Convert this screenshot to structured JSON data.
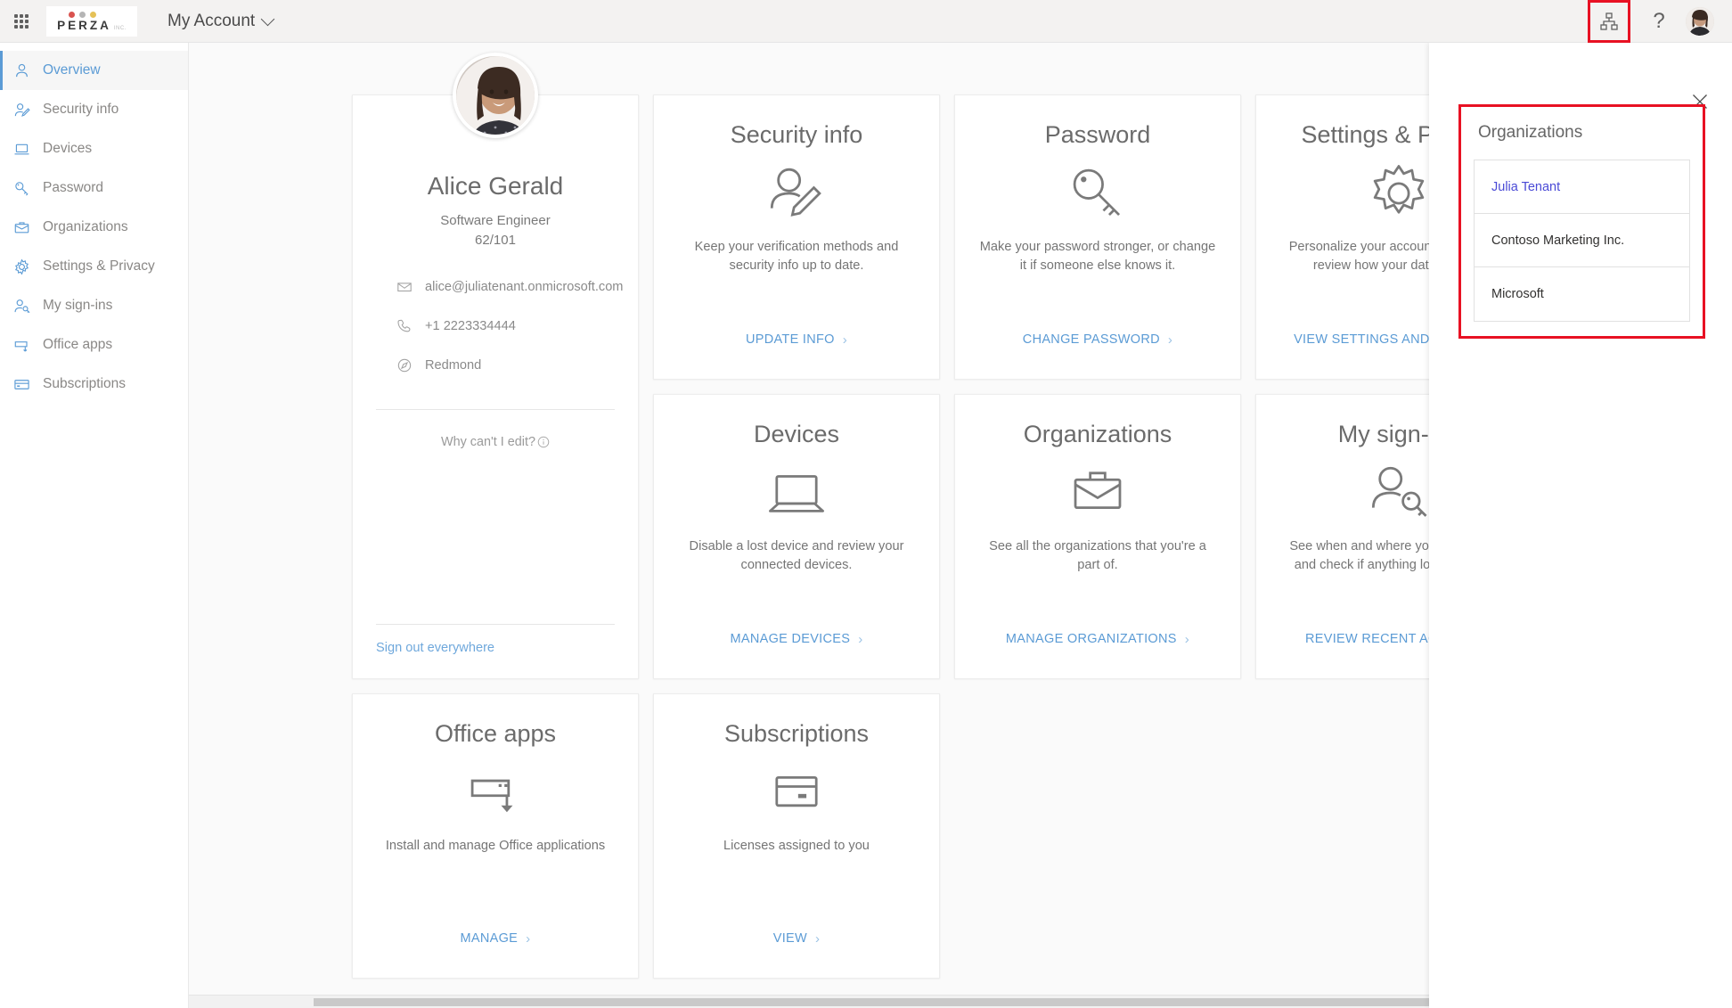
{
  "header": {
    "waffle_icon": "app-launcher-icon",
    "brand": {
      "name": "PERZA",
      "suffix": "INC.",
      "dot_colors": [
        "#d9534f",
        "#b5b5b5",
        "#e5c157"
      ]
    },
    "account_menu_label": "My Account",
    "org_chart_icon": "org-hierarchy-icon",
    "help_icon": "question-mark-icon",
    "help_label": "?",
    "avatar_label": "Alice Gerald"
  },
  "sidebar": {
    "items": [
      {
        "label": "Overview",
        "icon": "person-icon",
        "active": true
      },
      {
        "label": "Security info",
        "icon": "person-edit-icon",
        "active": false
      },
      {
        "label": "Devices",
        "icon": "laptop-icon",
        "active": false
      },
      {
        "label": "Password",
        "icon": "key-icon",
        "active": false
      },
      {
        "label": "Organizations",
        "icon": "briefcase-icon",
        "active": false
      },
      {
        "label": "Settings & Privacy",
        "icon": "gear-icon",
        "active": false
      },
      {
        "label": "My sign-ins",
        "icon": "person-key-icon",
        "active": false
      },
      {
        "label": "Office apps",
        "icon": "office-download-icon",
        "active": false
      },
      {
        "label": "Subscriptions",
        "icon": "credit-card-icon",
        "active": false
      }
    ]
  },
  "profile": {
    "name": "Alice Gerald",
    "title": "Software Engineer",
    "subtitle": "62/101",
    "email": "alice@juliatenant.onmicrosoft.com",
    "phone": "+1 2223334444",
    "location": "Redmond",
    "why_edit_label": "Why can't I edit?",
    "why_edit_icon": "info-circle-icon",
    "sign_out_label": "Sign out everywhere"
  },
  "cards": [
    {
      "title": "Security info",
      "icon": "person-edit-icon",
      "description": "Keep your verification methods and security info up to date.",
      "link": "UPDATE INFO"
    },
    {
      "title": "Password",
      "icon": "key-icon",
      "description": "Make your password stronger, or change it if someone else knows it.",
      "link": "CHANGE PASSWORD"
    },
    {
      "title": "Settings & Privacy",
      "icon": "gear-icon",
      "description": "Personalize your account settings and review how your data is used.",
      "link": "VIEW SETTINGS AND PRIVACY"
    },
    {
      "title": "Devices",
      "icon": "laptop-icon",
      "description": "Disable a lost device and review your connected devices.",
      "link": "MANAGE DEVICES"
    },
    {
      "title": "Organizations",
      "icon": "briefcase-icon",
      "description": "See all the organizations that you're a part of.",
      "link": "MANAGE ORGANIZATIONS"
    },
    {
      "title": "My sign-ins",
      "icon": "person-key-icon",
      "description": "See when and where you've signed in and check if anything looks unusual.",
      "link": "REVIEW RECENT ACTIVITY"
    },
    {
      "title": "Office apps",
      "icon": "office-download-icon",
      "description": "Install and manage Office applications",
      "link": "MANAGE"
    },
    {
      "title": "Subscriptions",
      "icon": "credit-card-icon",
      "description": "Licenses assigned to you",
      "link": "VIEW"
    }
  ],
  "org_panel": {
    "close_icon": "close-icon",
    "title": "Organizations",
    "highlight_color": "#e81123",
    "organizations": [
      {
        "name": "Julia Tenant",
        "selected": true
      },
      {
        "name": "Contoso Marketing Inc.",
        "selected": false
      },
      {
        "name": "Microsoft",
        "selected": false
      }
    ]
  },
  "colors": {
    "accent_link": "#5b9bd5",
    "highlight": "#e81123",
    "selected_org": "#4a4ad6",
    "header_bg": "#f3f2f1",
    "main_bg": "#fafafa"
  }
}
